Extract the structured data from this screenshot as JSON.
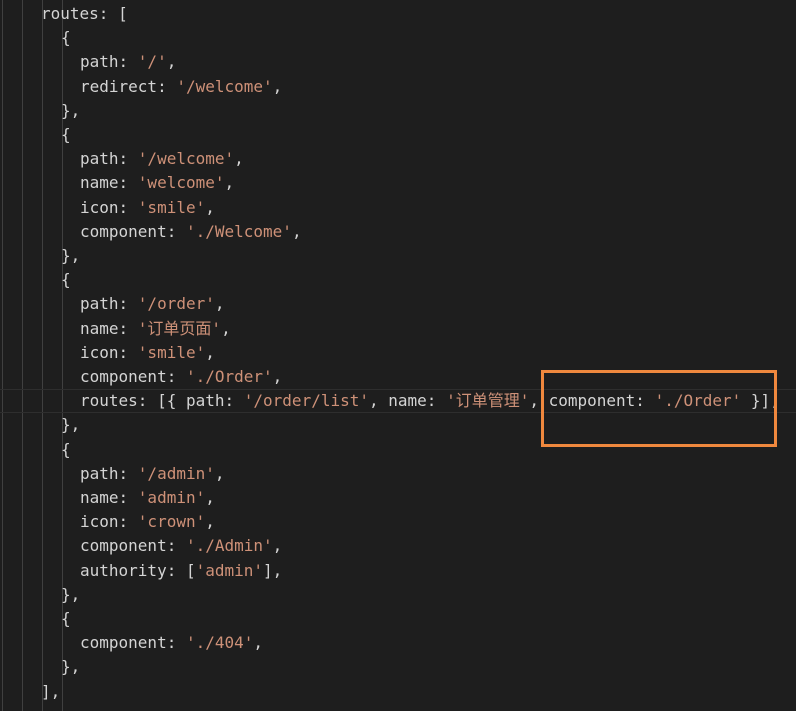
{
  "editor": {
    "highlight_color": "#f0883e",
    "colors": {
      "background": "#1e1e1e",
      "text": "#d4d4d4",
      "string": "#ce9178",
      "indent_guide": "#404040"
    },
    "lines": [
      {
        "indent": 2,
        "tokens": [
          {
            "t": "plain",
            "v": "routes: ["
          }
        ]
      },
      {
        "indent": 3,
        "tokens": [
          {
            "t": "plain",
            "v": "{"
          }
        ]
      },
      {
        "indent": 4,
        "tokens": [
          {
            "t": "plain",
            "v": "path: "
          },
          {
            "t": "str",
            "v": "'/'"
          },
          {
            "t": "plain",
            "v": ","
          }
        ]
      },
      {
        "indent": 4,
        "tokens": [
          {
            "t": "plain",
            "v": "redirect: "
          },
          {
            "t": "str",
            "v": "'/welcome'"
          },
          {
            "t": "plain",
            "v": ","
          }
        ]
      },
      {
        "indent": 3,
        "tokens": [
          {
            "t": "plain",
            "v": "},"
          }
        ]
      },
      {
        "indent": 3,
        "tokens": [
          {
            "t": "plain",
            "v": "{"
          }
        ]
      },
      {
        "indent": 4,
        "tokens": [
          {
            "t": "plain",
            "v": "path: "
          },
          {
            "t": "str",
            "v": "'/welcome'"
          },
          {
            "t": "plain",
            "v": ","
          }
        ]
      },
      {
        "indent": 4,
        "tokens": [
          {
            "t": "plain",
            "v": "name: "
          },
          {
            "t": "str",
            "v": "'welcome'"
          },
          {
            "t": "plain",
            "v": ","
          }
        ]
      },
      {
        "indent": 4,
        "tokens": [
          {
            "t": "plain",
            "v": "icon: "
          },
          {
            "t": "str",
            "v": "'smile'"
          },
          {
            "t": "plain",
            "v": ","
          }
        ]
      },
      {
        "indent": 4,
        "tokens": [
          {
            "t": "plain",
            "v": "component: "
          },
          {
            "t": "str",
            "v": "'./Welcome'"
          },
          {
            "t": "plain",
            "v": ","
          }
        ]
      },
      {
        "indent": 3,
        "tokens": [
          {
            "t": "plain",
            "v": "},"
          }
        ]
      },
      {
        "indent": 3,
        "tokens": [
          {
            "t": "plain",
            "v": "{"
          }
        ]
      },
      {
        "indent": 4,
        "tokens": [
          {
            "t": "plain",
            "v": "path: "
          },
          {
            "t": "str",
            "v": "'/order'"
          },
          {
            "t": "plain",
            "v": ","
          }
        ]
      },
      {
        "indent": 4,
        "tokens": [
          {
            "t": "plain",
            "v": "name: "
          },
          {
            "t": "str",
            "v": "'订单页面'"
          },
          {
            "t": "plain",
            "v": ","
          }
        ]
      },
      {
        "indent": 4,
        "tokens": [
          {
            "t": "plain",
            "v": "icon: "
          },
          {
            "t": "str",
            "v": "'smile'"
          },
          {
            "t": "plain",
            "v": ","
          }
        ]
      },
      {
        "indent": 4,
        "tokens": [
          {
            "t": "plain",
            "v": "component: "
          },
          {
            "t": "str",
            "v": "'./Order'"
          },
          {
            "t": "plain",
            "v": ","
          }
        ]
      },
      {
        "indent": 4,
        "current": true,
        "tokens": [
          {
            "t": "plain",
            "v": "routes: [{ path: "
          },
          {
            "t": "str",
            "v": "'/order/list'"
          },
          {
            "t": "plain",
            "v": ", name: "
          },
          {
            "t": "str",
            "v": "'订单管理'"
          },
          {
            "t": "plain",
            "v": ", component: "
          },
          {
            "t": "str",
            "v": "'./Order'"
          },
          {
            "t": "plain",
            "v": " }],"
          }
        ]
      },
      {
        "indent": 3,
        "tokens": [
          {
            "t": "plain",
            "v": "},"
          }
        ]
      },
      {
        "indent": 3,
        "tokens": [
          {
            "t": "plain",
            "v": "{"
          }
        ]
      },
      {
        "indent": 4,
        "tokens": [
          {
            "t": "plain",
            "v": "path: "
          },
          {
            "t": "str",
            "v": "'/admin'"
          },
          {
            "t": "plain",
            "v": ","
          }
        ]
      },
      {
        "indent": 4,
        "tokens": [
          {
            "t": "plain",
            "v": "name: "
          },
          {
            "t": "str",
            "v": "'admin'"
          },
          {
            "t": "plain",
            "v": ","
          }
        ]
      },
      {
        "indent": 4,
        "tokens": [
          {
            "t": "plain",
            "v": "icon: "
          },
          {
            "t": "str",
            "v": "'crown'"
          },
          {
            "t": "plain",
            "v": ","
          }
        ]
      },
      {
        "indent": 4,
        "tokens": [
          {
            "t": "plain",
            "v": "component: "
          },
          {
            "t": "str",
            "v": "'./Admin'"
          },
          {
            "t": "plain",
            "v": ","
          }
        ]
      },
      {
        "indent": 4,
        "tokens": [
          {
            "t": "plain",
            "v": "authority: ["
          },
          {
            "t": "str",
            "v": "'admin'"
          },
          {
            "t": "plain",
            "v": "],"
          }
        ]
      },
      {
        "indent": 3,
        "tokens": [
          {
            "t": "plain",
            "v": "},"
          }
        ]
      },
      {
        "indent": 3,
        "tokens": [
          {
            "t": "plain",
            "v": "{"
          }
        ]
      },
      {
        "indent": 4,
        "tokens": [
          {
            "t": "plain",
            "v": "component: "
          },
          {
            "t": "str",
            "v": "'./404'"
          },
          {
            "t": "plain",
            "v": ","
          }
        ]
      },
      {
        "indent": 3,
        "tokens": [
          {
            "t": "plain",
            "v": "},"
          }
        ]
      },
      {
        "indent": 2,
        "tokens": [
          {
            "t": "plain",
            "v": "],"
          }
        ]
      }
    ]
  }
}
